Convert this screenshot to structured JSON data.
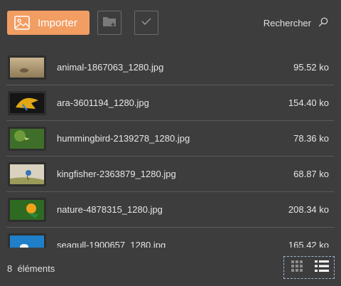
{
  "toolbar": {
    "import_label": "Importer",
    "search_label": "Rechercher",
    "colors": {
      "accent": "#f29d62"
    }
  },
  "files": [
    {
      "name": "animal-1867063_1280.jpg",
      "size": "95.52 ko"
    },
    {
      "name": "ara-3601194_1280.jpg",
      "size": "154.40 ko"
    },
    {
      "name": "hummingbird-2139278_1280.jpg",
      "size": "78.36 ko"
    },
    {
      "name": "kingfisher-2363879_1280.jpg",
      "size": "68.87 ko"
    },
    {
      "name": "nature-4878315_1280.jpg",
      "size": "208.34 ko"
    },
    {
      "name": "seagull-1900657_1280.jpg",
      "size": "165.42 ko"
    }
  ],
  "footer": {
    "count_label": "8  éléments"
  },
  "icons": {
    "import": "image-icon",
    "new_folder": "folder-add-icon",
    "select": "checkmark-icon",
    "search": "search-icon",
    "grid_view": "grid-view-icon",
    "list_view": "list-view-icon"
  }
}
